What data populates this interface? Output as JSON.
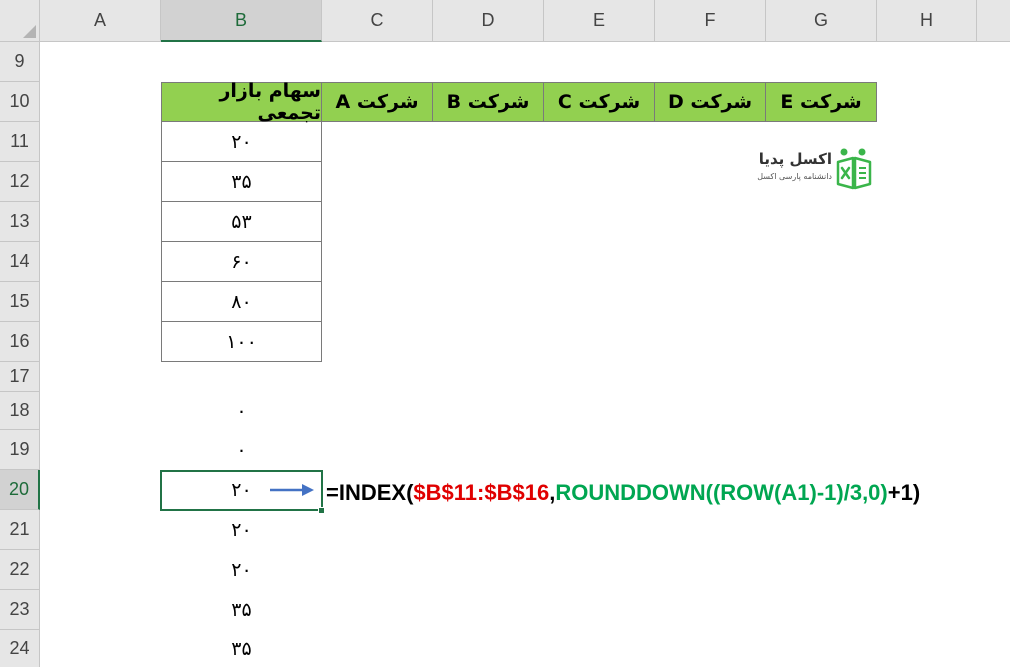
{
  "column_headers": [
    "A",
    "B",
    "C",
    "D",
    "E",
    "F",
    "G",
    "H"
  ],
  "row_headers": [
    "9",
    "10",
    "11",
    "12",
    "13",
    "14",
    "15",
    "16",
    "17",
    "18",
    "19",
    "20",
    "21",
    "22",
    "23",
    "24"
  ],
  "table_headers": [
    "سهام بازار تجمعی",
    "شرکت A",
    "شرکت B",
    "شرکت C",
    "شرکت D",
    "شرکت E"
  ],
  "column_b_values": [
    "۲۰",
    "۳۵",
    "۵۳",
    "۶۰",
    "۸۰",
    "۱۰۰"
  ],
  "results": [
    "۰",
    "۰",
    "۲۰",
    "۲۰",
    "۲۰",
    "۳۵",
    "۳۵"
  ],
  "active_cell": "B20",
  "formula": {
    "prefix": "=INDEX(",
    "range": "$B$11:$B$16",
    "comma": ",",
    "func": "ROUNDDOWN((ROW(A1)-1)/3,0)",
    "suffix": "+1)"
  },
  "logo": {
    "title": "اکسل پدیا",
    "subtitle": "دانشنامه پارسی اکسل"
  },
  "colors": {
    "header_fill": "#92d050",
    "range_text": "#e00000",
    "func_text": "#00a651",
    "selection": "#217346",
    "arrow": "#4472c4"
  }
}
